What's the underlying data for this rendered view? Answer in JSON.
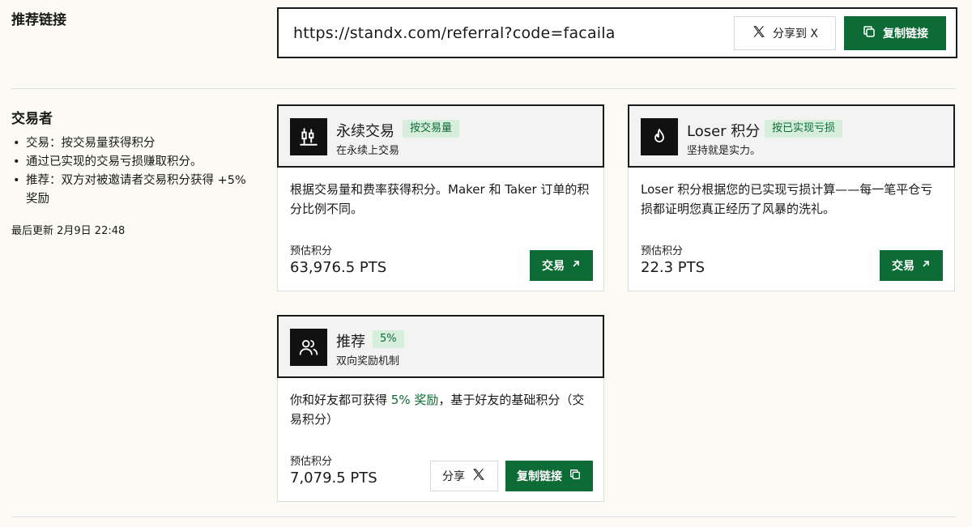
{
  "referral": {
    "section_title": "推荐链接",
    "url": "https://standx.com/referral?code=facaila",
    "share_label": "分享到 X",
    "copy_label": "复制链接"
  },
  "traders": {
    "title": "交易者",
    "bullets": [
      "交易：按交易量获得积分",
      "通过已实现的交易亏损赚取积分。",
      "推荐：双方对被邀请者交易积分获得 +5% 奖励"
    ],
    "updated": "最后更新 2月9日 22:48"
  },
  "cards": {
    "perp": {
      "name": "永续交易",
      "badge": "按交易量",
      "sub": "在永续上交易",
      "desc": "根据交易量和费率获得积分。Maker 和 Taker 订单的积分比例不同。",
      "est_label": "预估积分",
      "est_value": "63,976.5 PTS",
      "button": "交易"
    },
    "loser": {
      "name": "Loser 积分",
      "badge": "按已实现亏损",
      "sub": "坚持就是实力。",
      "desc": "Loser 积分根据您的已实现亏损计算——每一笔平仓亏损都证明您真正经历了风暴的洗礼。",
      "est_label": "预估积分",
      "est_value": "22.3 PTS",
      "button": "交易"
    },
    "referral": {
      "name": "推荐",
      "badge": "5%",
      "sub": "双向奖励机制",
      "desc_before": "你和好友都可获得 ",
      "desc_highlight": "5% 奖励",
      "desc_after": "，基于好友的基础积分（交易积分）",
      "est_label": "预估积分",
      "est_value": "7,079.5 PTS",
      "share_label": "分享",
      "copy_label": "复制链接"
    }
  },
  "colors": {
    "accent": "#0d6b35",
    "badge_bg": "#d7eedd",
    "page_bg": "#fbfaf5"
  }
}
